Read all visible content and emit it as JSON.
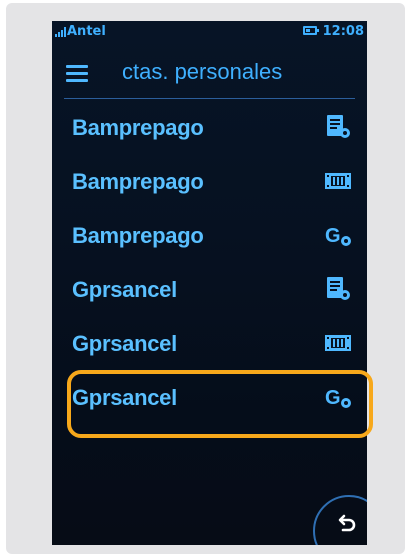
{
  "status": {
    "carrier": "Antel",
    "time": "12:08"
  },
  "header": {
    "title": "ctas. personales",
    "menu_icon": "hamburger-menu-icon"
  },
  "accounts": [
    {
      "name": "Bamprepago",
      "icon": "document-settings-icon"
    },
    {
      "name": "Bamprepago",
      "icon": "film-strip-icon"
    },
    {
      "name": "Bamprepago",
      "icon": "g-settings-icon"
    },
    {
      "name": "Gprsancel",
      "icon": "document-settings-icon"
    },
    {
      "name": "Gprsancel",
      "icon": "film-strip-icon"
    },
    {
      "name": "Gprsancel",
      "icon": "g-settings-icon"
    }
  ],
  "back_button": {
    "icon": "back-arrow-icon"
  },
  "colors": {
    "accent": "#3fb0ff",
    "highlight": "#f7a81b",
    "background": "#061121"
  }
}
